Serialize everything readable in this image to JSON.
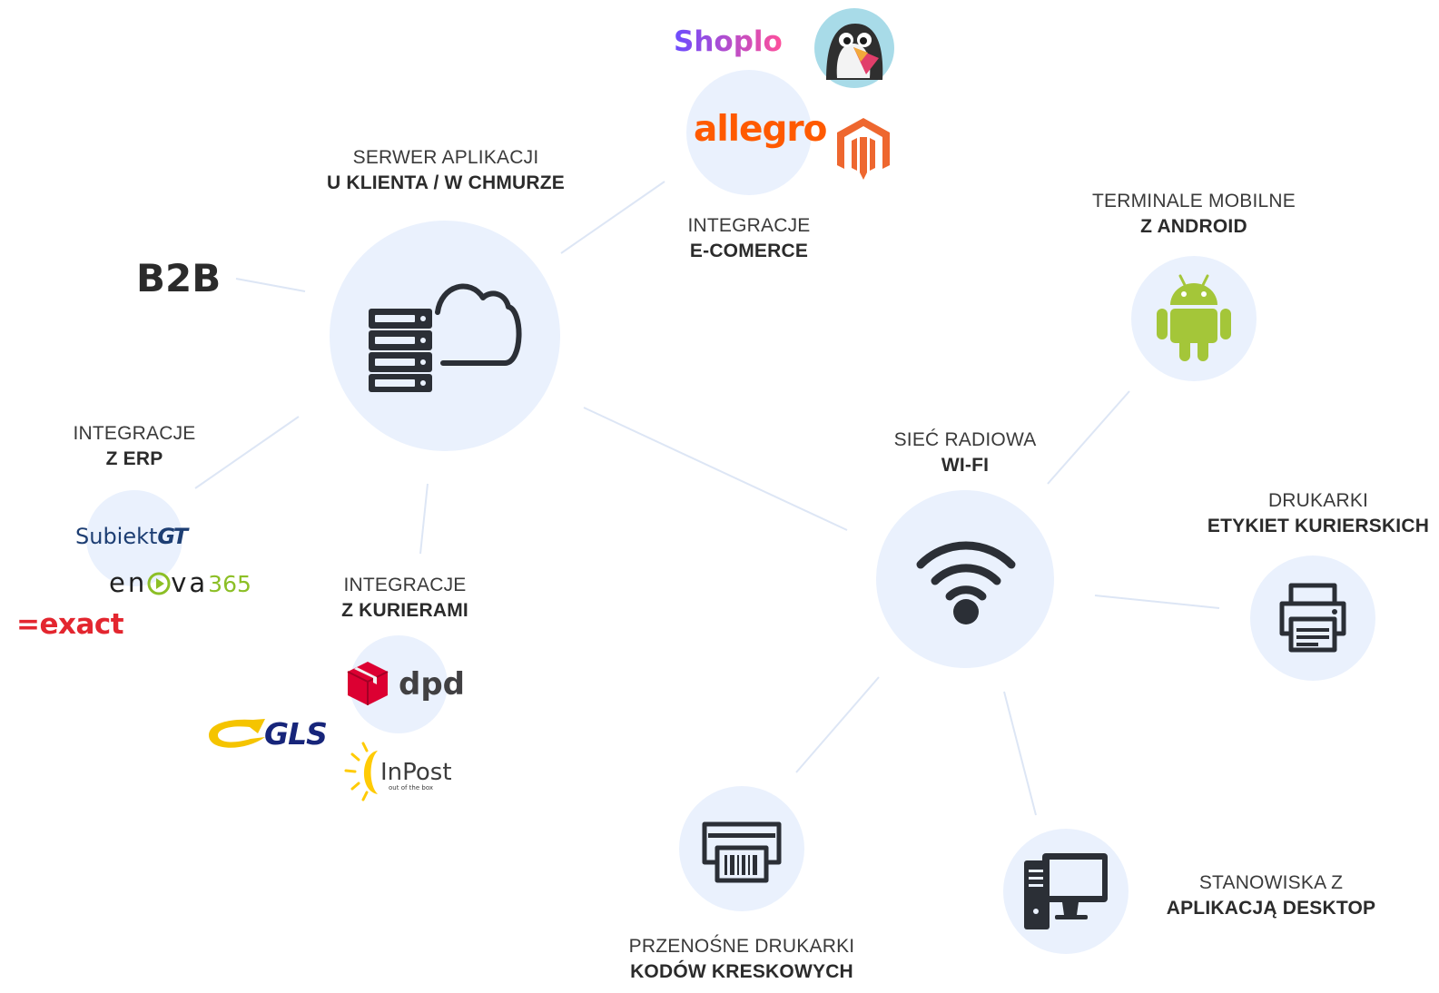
{
  "labels": {
    "server": {
      "line1": "SERWER APLIKACJI",
      "line2": "U KLIENTA / W CHMURZE"
    },
    "ecommerce": {
      "line1": "INTEGRACJE",
      "line2": "E-COMERCE"
    },
    "android": {
      "line1": "TERMINALE MOBILNE",
      "line2": "Z ANDROID"
    },
    "wifi": {
      "line1": "SIEĆ RADIOWA",
      "line2": "WI-FI"
    },
    "erp": {
      "line1": "INTEGRACJE",
      "line2": "Z ERP"
    },
    "couriers": {
      "line1": "INTEGRACJE",
      "line2": "Z KURIERAMI"
    },
    "label_printers": {
      "line1": "DRUKARKI",
      "line2": "ETYKIET KURIERSKICH"
    },
    "desktop": {
      "line1": "STANOWISKA Z",
      "line2": "APLIKACJĄ DESKTOP"
    },
    "barcode_printers": {
      "line1": "PRZENOŚNE DRUKARKI",
      "line2": "KODÓW KRESKOWYCH"
    }
  },
  "b2b": "B2B",
  "logos": {
    "shoplo": "Shoplo",
    "allegro": "allegro",
    "subiekt": "Subiekt",
    "subiekt_suffix": "GT",
    "enova": "en",
    "enova_mid": "va",
    "enova_num": "365",
    "exact": "=exact",
    "dpd": "dpd",
    "gls": "GLS",
    "inpost": "InPost",
    "inpost_tag": "out of the box"
  },
  "icons": {
    "server_cloud": "server-cloud-icon",
    "wifi": "wifi-icon",
    "android": "android-icon",
    "printer": "printer-icon",
    "desktop": "desktop-computer-icon",
    "barcode_printer": "barcode-printer-icon",
    "prestashop": "prestashop-puffin-icon",
    "magento": "magento-icon",
    "dpd_cube": "dpd-cube-icon",
    "gls_swoosh": "gls-swoosh-icon",
    "inpost_sun": "inpost-sun-icon",
    "enova_play": "enova-play-icon"
  },
  "colors": {
    "node_fill": "#eaf1fd",
    "connector": "#dde6f5",
    "icon_dark": "#2b2f36",
    "android_green": "#a4c639",
    "allegro_orange": "#ff5a00",
    "magento_orange": "#ee672f",
    "exact_red": "#e3262f",
    "dpd_red": "#dc0032",
    "gls_blue": "#17257a",
    "gls_yellow": "#f5c400",
    "inpost_yellow": "#ffcb05"
  }
}
